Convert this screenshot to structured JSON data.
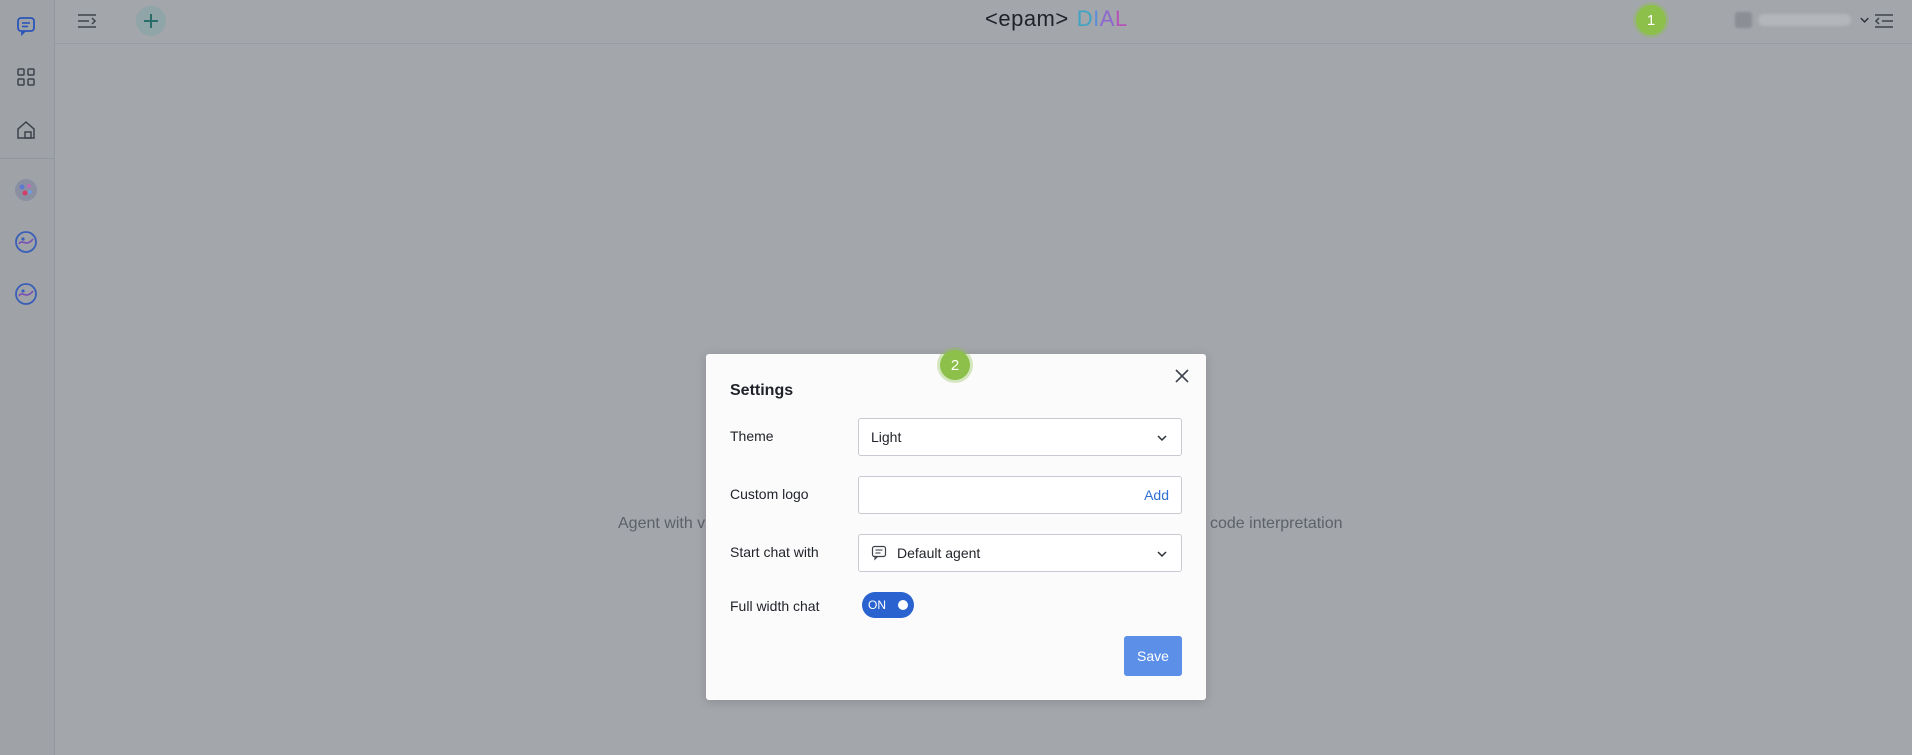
{
  "app": {
    "logo_prefix": "<epam>",
    "logo_dial": [
      "D",
      "I",
      "A",
      "L"
    ]
  },
  "rail": {
    "items": [
      {
        "icon": "chat-icon"
      },
      {
        "icon": "marketplace-grid-icon"
      },
      {
        "icon": "home-icon"
      },
      {
        "icon": "agent-avatar-icon"
      },
      {
        "icon": "agent-avatar-icon"
      },
      {
        "icon": "agent-avatar-icon"
      }
    ]
  },
  "header": {
    "left_icons": [
      "collapse-sidebar-icon",
      "new-conversation-icon"
    ],
    "right_icons": [
      "user-dropdown-chevron-icon",
      "collapse-right-panel-icon"
    ]
  },
  "markers": {
    "marker1": "1",
    "marker2": "2"
  },
  "background": {
    "text_left": "Agent with v",
    "text_right": "code interpretation"
  },
  "settings": {
    "title": "Settings",
    "theme_label": "Theme",
    "theme_value": "Light",
    "custom_logo_label": "Custom logo",
    "custom_logo_value": "",
    "add_label": "Add",
    "start_chat_label": "Start chat with",
    "start_chat_value": "Default agent",
    "full_width_label": "Full width chat",
    "full_width_toggle": "ON",
    "save_label": "Save"
  },
  "colors": {
    "accent": "#2a63d0",
    "save_button": "#5b8fe8",
    "marker": "#8cc04a",
    "add_link": "#2f6fd6"
  }
}
